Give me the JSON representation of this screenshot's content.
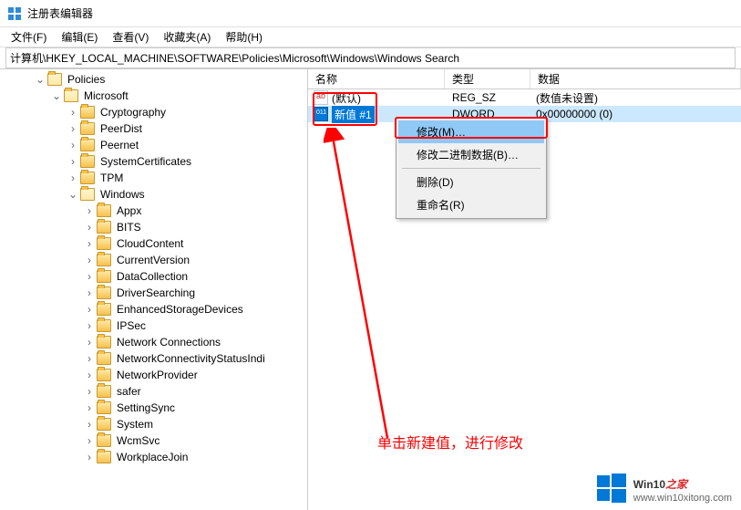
{
  "title": "注册表编辑器",
  "menu": {
    "file": "文件(F)",
    "edit": "编辑(E)",
    "view": "查看(V)",
    "fav": "收藏夹(A)",
    "help": "帮助(H)"
  },
  "address": "计算机\\HKEY_LOCAL_MACHINE\\SOFTWARE\\Policies\\Microsoft\\Windows\\Windows Search",
  "columns": {
    "name": "名称",
    "type": "类型",
    "data": "数据"
  },
  "rows": [
    {
      "icon": "str",
      "name": "(默认)",
      "type": "REG_SZ",
      "data": "(数值未设置)",
      "editing": false
    },
    {
      "icon": "bin",
      "name": "新值 #1",
      "type": "DWORD",
      "data": "0x00000000 (0)",
      "editing": true
    }
  ],
  "context_menu": {
    "modify": "修改(M)…",
    "modify_bin": "修改二进制数据(B)…",
    "delete": "删除(D)",
    "rename": "重命名(R)"
  },
  "tree": {
    "policies": "Policies",
    "microsoft": "Microsoft",
    "microsoft_children": [
      "Cryptography",
      "PeerDist",
      "Peernet",
      "SystemCertificates",
      "TPM"
    ],
    "windows": "Windows",
    "windows_children": [
      "Appx",
      "BITS",
      "CloudContent",
      "CurrentVersion",
      "DataCollection",
      "DriverSearching",
      "EnhancedStorageDevices",
      "IPSec",
      "Network Connections",
      "NetworkConnectivityStatusIndi",
      "NetworkProvider",
      "safer",
      "SettingSync",
      "System",
      "WcmSvc",
      "WorkplaceJoin"
    ]
  },
  "annotation": "单击新建值，进行修改",
  "watermark": {
    "brand_main": "Win10",
    "brand_suffix": "之家",
    "url": "www.win10xitong.com"
  }
}
